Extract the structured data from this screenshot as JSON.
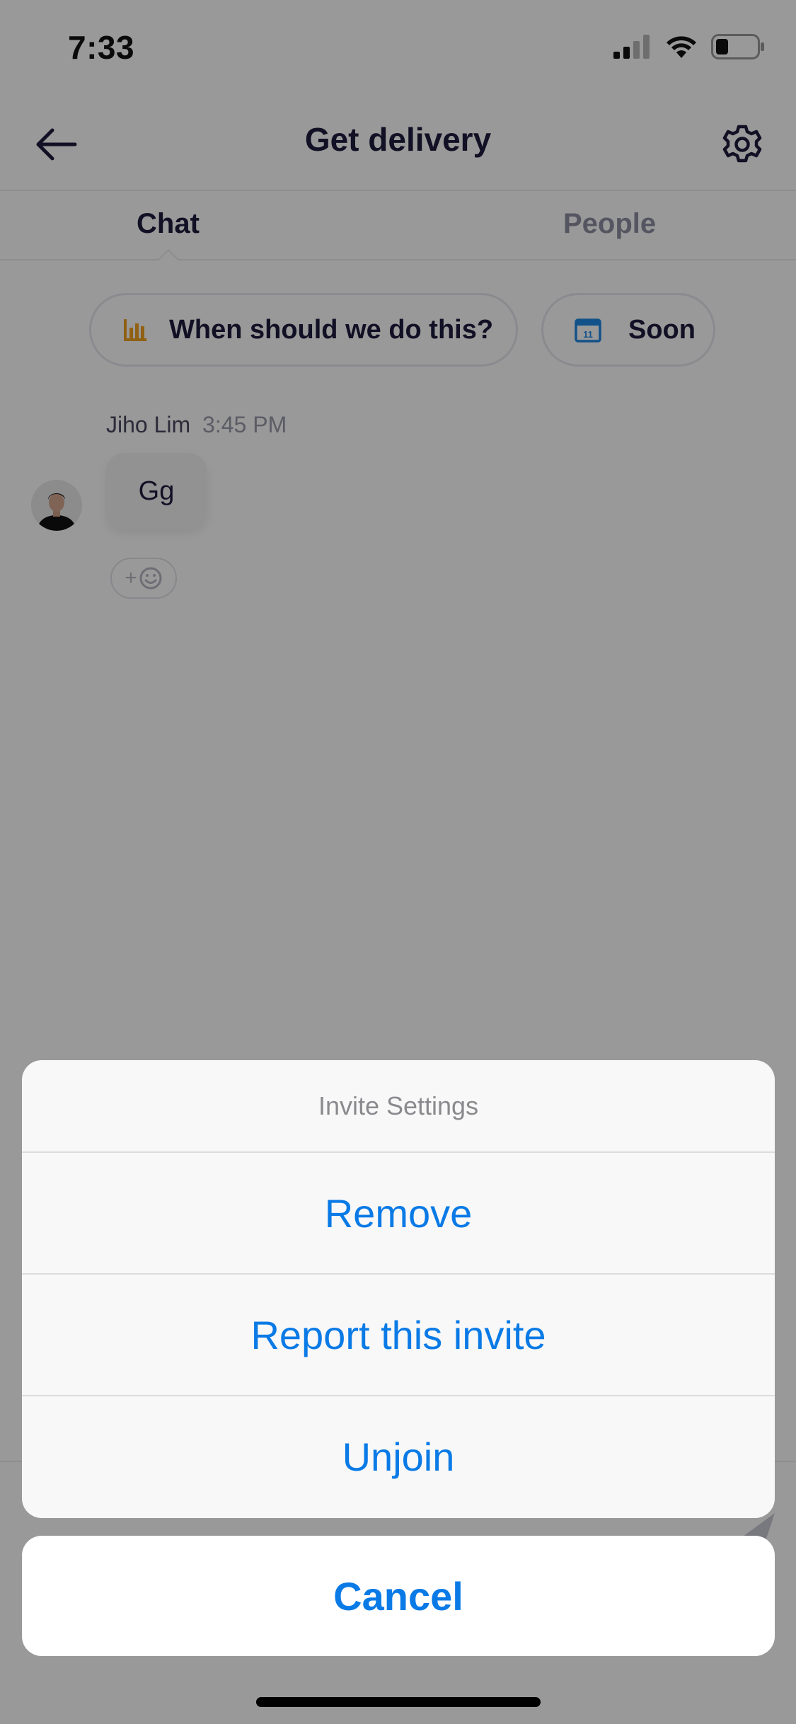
{
  "status_bar": {
    "time": "7:33"
  },
  "header": {
    "title": "Get delivery"
  },
  "tabs": [
    {
      "label": "Chat",
      "active": true
    },
    {
      "label": "People",
      "active": false
    }
  ],
  "chips": {
    "when": {
      "label": "When should we do this?",
      "icon": "bar-chart-icon",
      "icon_color": "#f0a020"
    },
    "soon": {
      "label": "Soon",
      "icon": "calendar-icon",
      "calendar_day": "11",
      "icon_color": "#1e88e5"
    }
  },
  "message": {
    "sender": "Jiho Lim",
    "time": "3:45 PM",
    "text": "Gg",
    "reaction_button": "+"
  },
  "action_sheet": {
    "title": "Invite Settings",
    "items": [
      {
        "label": "Remove"
      },
      {
        "label": "Report this invite"
      },
      {
        "label": "Unjoin"
      }
    ],
    "cancel_label": "Cancel"
  },
  "colors": {
    "action_blue": "#0a7ae6",
    "text_dark": "#1f1b3d",
    "overlay": "rgba(0,0,0,0.40)"
  }
}
